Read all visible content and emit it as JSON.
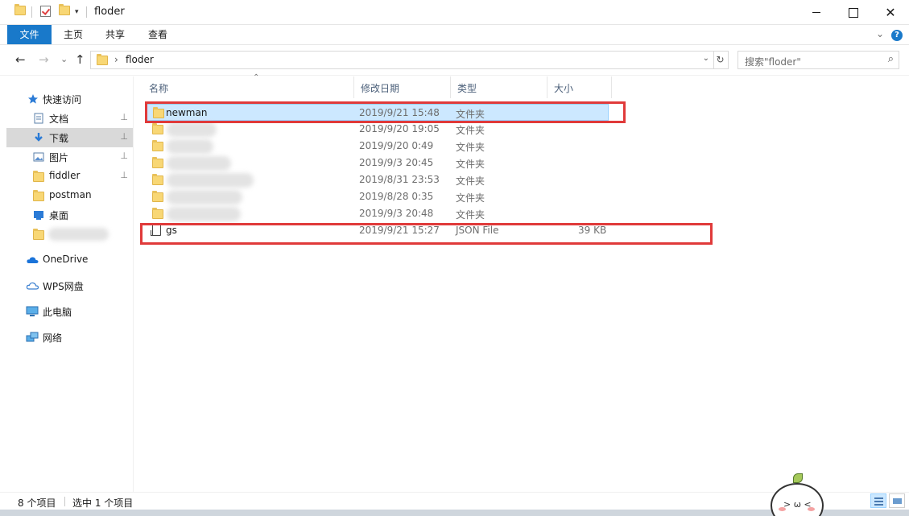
{
  "window": {
    "title": "floder",
    "controls": {
      "minimize_icon": "minimize-icon",
      "maximize_icon": "maximize-icon",
      "close_glyph": "✕"
    }
  },
  "ribbon": {
    "tabs": [
      {
        "label": "文件",
        "active": true
      },
      {
        "label": "主页"
      },
      {
        "label": "共享"
      },
      {
        "label": "查看"
      }
    ],
    "expand_glyph": "⌄",
    "help_glyph": "?"
  },
  "navigation": {
    "back_glyph": "←",
    "forward_glyph": "→",
    "recent_glyph": "⌄",
    "up_glyph": "↑",
    "address": {
      "chevron": "›",
      "path": "floder",
      "dropdown_glyph": "⌄"
    },
    "refresh_glyph": "↻",
    "search_placeholder": "搜索\"floder\"",
    "search_glyph": "⌕"
  },
  "sidebar": {
    "items": [
      {
        "label": "快速访问",
        "icon": "star-icon",
        "pinned": false
      },
      {
        "label": "文档",
        "icon": "document-icon",
        "pinned": true
      },
      {
        "label": "下载",
        "icon": "download-icon",
        "pinned": true,
        "selected": true
      },
      {
        "label": "图片",
        "icon": "picture-icon",
        "pinned": true
      },
      {
        "label": "fiddler",
        "icon": "folder-icon",
        "pinned": true
      },
      {
        "label": "postman",
        "icon": "folder-icon",
        "pinned": false
      },
      {
        "label": "桌面",
        "icon": "desktop-icon",
        "pinned": false
      },
      {
        "label": "OneDrive",
        "icon": "cloud-icon"
      },
      {
        "label": "WPS网盘",
        "icon": "cloud-outline-icon"
      },
      {
        "label": "此电脑",
        "icon": "computer-icon"
      },
      {
        "label": "网络",
        "icon": "network-icon"
      }
    ],
    "pin_glyph": "📌"
  },
  "columns": [
    "名称",
    "修改日期",
    "类型",
    "大小"
  ],
  "sort_glyph": "⌃",
  "files": [
    {
      "name": "newman",
      "date": "2019/9/21 15:48",
      "type": "文件夹",
      "size": "",
      "kind": "folder"
    },
    {
      "name": "",
      "date": "2019/9/20 19:05",
      "type": "文件夹",
      "size": "",
      "kind": "folder",
      "name_obscured": true
    },
    {
      "name": "",
      "date": "2019/9/20 0:49",
      "type": "文件夹",
      "size": "",
      "kind": "folder",
      "name_obscured": true
    },
    {
      "name": "",
      "date": "2019/9/3 20:45",
      "type": "文件夹",
      "size": "",
      "kind": "folder",
      "name_obscured": true
    },
    {
      "name": "",
      "date": "2019/8/31 23:53",
      "type": "文件夹",
      "size": "",
      "kind": "folder",
      "name_obscured": true
    },
    {
      "name": "",
      "date": "2019/8/28 0:35",
      "type": "文件夹",
      "size": "",
      "kind": "folder",
      "name_obscured": true
    },
    {
      "name": "",
      "date": "2019/9/3 20:48",
      "type": "文件夹",
      "size": "",
      "kind": "folder",
      "name_obscured": true
    },
    {
      "name": "gs",
      "date": "2019/9/21 15:27",
      "type": "JSON File",
      "size": "39 KB",
      "kind": "json"
    }
  ],
  "highlight_color": "#e03a3a",
  "status": {
    "item_count": "8 个项目",
    "selection": "选中 1 个项目"
  },
  "accent_color": "#1979ca"
}
